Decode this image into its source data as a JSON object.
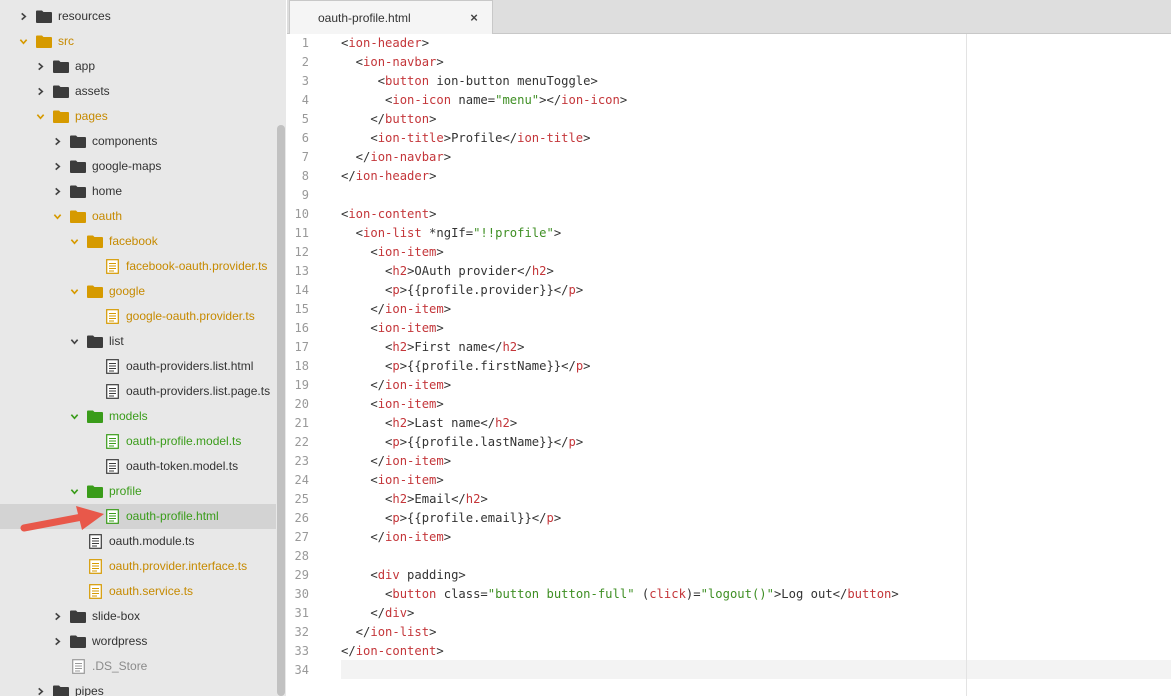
{
  "sidebar": {
    "items": [
      {
        "label": "resources",
        "indent": 1,
        "chevron": "right",
        "icon": "folder",
        "color": "dark"
      },
      {
        "label": "src",
        "indent": 1,
        "chevron": "down",
        "icon": "folder",
        "color": "orange"
      },
      {
        "label": "app",
        "indent": 2,
        "chevron": "right",
        "icon": "folder",
        "color": "dark"
      },
      {
        "label": "assets",
        "indent": 2,
        "chevron": "right",
        "icon": "folder",
        "color": "dark"
      },
      {
        "label": "pages",
        "indent": 2,
        "chevron": "down",
        "icon": "folder",
        "color": "orange"
      },
      {
        "label": "components",
        "indent": 3,
        "chevron": "right",
        "icon": "folder",
        "color": "dark"
      },
      {
        "label": "google-maps",
        "indent": 3,
        "chevron": "right",
        "icon": "folder",
        "color": "dark"
      },
      {
        "label": "home",
        "indent": 3,
        "chevron": "right",
        "icon": "folder",
        "color": "dark"
      },
      {
        "label": "oauth",
        "indent": 3,
        "chevron": "down",
        "icon": "folder",
        "color": "orange"
      },
      {
        "label": "facebook",
        "indent": 4,
        "chevron": "down",
        "icon": "folder",
        "color": "orange"
      },
      {
        "label": "facebook-oauth.provider.ts",
        "indent": 5,
        "chevron": "none",
        "icon": "file",
        "color": "orange"
      },
      {
        "label": "google",
        "indent": 4,
        "chevron": "down",
        "icon": "folder",
        "color": "orange"
      },
      {
        "label": "google-oauth.provider.ts",
        "indent": 5,
        "chevron": "none",
        "icon": "file",
        "color": "orange"
      },
      {
        "label": "list",
        "indent": 4,
        "chevron": "down",
        "icon": "folder",
        "color": "dark"
      },
      {
        "label": "oauth-providers.list.html",
        "indent": 5,
        "chevron": "none",
        "icon": "file",
        "color": "dark"
      },
      {
        "label": "oauth-providers.list.page.ts",
        "indent": 5,
        "chevron": "none",
        "icon": "file",
        "color": "dark"
      },
      {
        "label": "models",
        "indent": 4,
        "chevron": "down",
        "icon": "folder",
        "color": "green"
      },
      {
        "label": "oauth-profile.model.ts",
        "indent": 5,
        "chevron": "none",
        "icon": "file",
        "color": "green"
      },
      {
        "label": "oauth-token.model.ts",
        "indent": 5,
        "chevron": "none",
        "icon": "file",
        "color": "dark"
      },
      {
        "label": "profile",
        "indent": 4,
        "chevron": "down",
        "icon": "folder",
        "color": "green"
      },
      {
        "label": "oauth-profile.html",
        "indent": 5,
        "chevron": "none",
        "icon": "file",
        "color": "green",
        "selected": true
      },
      {
        "label": "oauth.module.ts",
        "indent": 4,
        "chevron": "none",
        "icon": "file",
        "color": "dark"
      },
      {
        "label": "oauth.provider.interface.ts",
        "indent": 4,
        "chevron": "none",
        "icon": "file",
        "color": "orange"
      },
      {
        "label": "oauth.service.ts",
        "indent": 4,
        "chevron": "none",
        "icon": "file",
        "color": "orange"
      },
      {
        "label": "slide-box",
        "indent": 3,
        "chevron": "right",
        "icon": "folder",
        "color": "dark"
      },
      {
        "label": "wordpress",
        "indent": 3,
        "chevron": "right",
        "icon": "folder",
        "color": "dark"
      },
      {
        "label": ".DS_Store",
        "indent": 3,
        "chevron": "none",
        "icon": "file",
        "color": "grey"
      },
      {
        "label": "pipes",
        "indent": 2,
        "chevron": "right",
        "icon": "folder",
        "color": "dark"
      }
    ]
  },
  "tabs": [
    {
      "label": "oauth-profile.html",
      "close_glyph": "×"
    }
  ],
  "colors": {
    "dark": "#333333",
    "orange": "#c68a00",
    "green": "#3a9c1a",
    "grey": "#8a8a8a",
    "tag": "#c4363a",
    "string": "#3f8f24",
    "arrow": "#e8584a"
  },
  "editor": {
    "lines": [
      [
        {
          "t": "",
          "c": "a"
        },
        {
          "t": "<",
          "c": "a"
        },
        {
          "t": "ion-header",
          "c": "t"
        },
        {
          "t": ">",
          "c": "a"
        }
      ],
      [
        {
          "t": "  <",
          "c": "a"
        },
        {
          "t": "ion-navbar",
          "c": "t"
        },
        {
          "t": ">",
          "c": "a"
        }
      ],
      [
        {
          "t": "     <",
          "c": "a"
        },
        {
          "t": "button",
          "c": "t"
        },
        {
          "t": " ion-button menuToggle>",
          "c": "a"
        }
      ],
      [
        {
          "t": "      <",
          "c": "a"
        },
        {
          "t": "ion-icon",
          "c": "t"
        },
        {
          "t": " name=",
          "c": "a"
        },
        {
          "t": "\"menu\"",
          "c": "s"
        },
        {
          "t": "></",
          "c": "a"
        },
        {
          "t": "ion-icon",
          "c": "t"
        },
        {
          "t": ">",
          "c": "a"
        }
      ],
      [
        {
          "t": "    </",
          "c": "a"
        },
        {
          "t": "button",
          "c": "t"
        },
        {
          "t": ">",
          "c": "a"
        }
      ],
      [
        {
          "t": "    <",
          "c": "a"
        },
        {
          "t": "ion-title",
          "c": "t"
        },
        {
          "t": ">Profile</",
          "c": "a"
        },
        {
          "t": "ion-title",
          "c": "t"
        },
        {
          "t": ">",
          "c": "a"
        }
      ],
      [
        {
          "t": "  </",
          "c": "a"
        },
        {
          "t": "ion-navbar",
          "c": "t"
        },
        {
          "t": ">",
          "c": "a"
        }
      ],
      [
        {
          "t": "</",
          "c": "a"
        },
        {
          "t": "ion-header",
          "c": "t"
        },
        {
          "t": ">",
          "c": "a"
        }
      ],
      [],
      [
        {
          "t": "<",
          "c": "a"
        },
        {
          "t": "ion-content",
          "c": "t"
        },
        {
          "t": ">",
          "c": "a"
        }
      ],
      [
        {
          "t": "  <",
          "c": "a"
        },
        {
          "t": "ion-list",
          "c": "t"
        },
        {
          "t": " *ngIf=",
          "c": "a"
        },
        {
          "t": "\"!!profile\"",
          "c": "s"
        },
        {
          "t": ">",
          "c": "a"
        }
      ],
      [
        {
          "t": "    <",
          "c": "a"
        },
        {
          "t": "ion-item",
          "c": "t"
        },
        {
          "t": ">",
          "c": "a"
        }
      ],
      [
        {
          "t": "      <",
          "c": "a"
        },
        {
          "t": "h2",
          "c": "t"
        },
        {
          "t": ">OAuth provider</",
          "c": "a"
        },
        {
          "t": "h2",
          "c": "t"
        },
        {
          "t": ">",
          "c": "a"
        }
      ],
      [
        {
          "t": "      <",
          "c": "a"
        },
        {
          "t": "p",
          "c": "t"
        },
        {
          "t": ">{{profile.provider}}</",
          "c": "a"
        },
        {
          "t": "p",
          "c": "t"
        },
        {
          "t": ">",
          "c": "a"
        }
      ],
      [
        {
          "t": "    </",
          "c": "a"
        },
        {
          "t": "ion-item",
          "c": "t"
        },
        {
          "t": ">",
          "c": "a"
        }
      ],
      [
        {
          "t": "    <",
          "c": "a"
        },
        {
          "t": "ion-item",
          "c": "t"
        },
        {
          "t": ">",
          "c": "a"
        }
      ],
      [
        {
          "t": "      <",
          "c": "a"
        },
        {
          "t": "h2",
          "c": "t"
        },
        {
          "t": ">First name</",
          "c": "a"
        },
        {
          "t": "h2",
          "c": "t"
        },
        {
          "t": ">",
          "c": "a"
        }
      ],
      [
        {
          "t": "      <",
          "c": "a"
        },
        {
          "t": "p",
          "c": "t"
        },
        {
          "t": ">{{profile.firstName}}</",
          "c": "a"
        },
        {
          "t": "p",
          "c": "t"
        },
        {
          "t": ">",
          "c": "a"
        }
      ],
      [
        {
          "t": "    </",
          "c": "a"
        },
        {
          "t": "ion-item",
          "c": "t"
        },
        {
          "t": ">",
          "c": "a"
        }
      ],
      [
        {
          "t": "    <",
          "c": "a"
        },
        {
          "t": "ion-item",
          "c": "t"
        },
        {
          "t": ">",
          "c": "a"
        }
      ],
      [
        {
          "t": "      <",
          "c": "a"
        },
        {
          "t": "h2",
          "c": "t"
        },
        {
          "t": ">Last name</",
          "c": "a"
        },
        {
          "t": "h2",
          "c": "t"
        },
        {
          "t": ">",
          "c": "a"
        }
      ],
      [
        {
          "t": "      <",
          "c": "a"
        },
        {
          "t": "p",
          "c": "t"
        },
        {
          "t": ">{{profile.lastName}}</",
          "c": "a"
        },
        {
          "t": "p",
          "c": "t"
        },
        {
          "t": ">",
          "c": "a"
        }
      ],
      [
        {
          "t": "    </",
          "c": "a"
        },
        {
          "t": "ion-item",
          "c": "t"
        },
        {
          "t": ">",
          "c": "a"
        }
      ],
      [
        {
          "t": "    <",
          "c": "a"
        },
        {
          "t": "ion-item",
          "c": "t"
        },
        {
          "t": ">",
          "c": "a"
        }
      ],
      [
        {
          "t": "      <",
          "c": "a"
        },
        {
          "t": "h2",
          "c": "t"
        },
        {
          "t": ">Email</",
          "c": "a"
        },
        {
          "t": "h2",
          "c": "t"
        },
        {
          "t": ">",
          "c": "a"
        }
      ],
      [
        {
          "t": "      <",
          "c": "a"
        },
        {
          "t": "p",
          "c": "t"
        },
        {
          "t": ">{{profile.email}}</",
          "c": "a"
        },
        {
          "t": "p",
          "c": "t"
        },
        {
          "t": ">",
          "c": "a"
        }
      ],
      [
        {
          "t": "    </",
          "c": "a"
        },
        {
          "t": "ion-item",
          "c": "t"
        },
        {
          "t": ">",
          "c": "a"
        }
      ],
      [],
      [
        {
          "t": "    <",
          "c": "a"
        },
        {
          "t": "div",
          "c": "t"
        },
        {
          "t": " padding>",
          "c": "a"
        }
      ],
      [
        {
          "t": "      <",
          "c": "a"
        },
        {
          "t": "button",
          "c": "t"
        },
        {
          "t": " class=",
          "c": "a"
        },
        {
          "t": "\"button button-full\"",
          "c": "s"
        },
        {
          "t": " (",
          "c": "a"
        },
        {
          "t": "click",
          "c": "t"
        },
        {
          "t": ")=",
          "c": "a"
        },
        {
          "t": "\"logout()\"",
          "c": "s"
        },
        {
          "t": ">Log out</",
          "c": "a"
        },
        {
          "t": "button",
          "c": "t"
        },
        {
          "t": ">",
          "c": "a"
        }
      ],
      [
        {
          "t": "    </",
          "c": "a"
        },
        {
          "t": "div",
          "c": "t"
        },
        {
          "t": ">",
          "c": "a"
        }
      ],
      [
        {
          "t": "  </",
          "c": "a"
        },
        {
          "t": "ion-list",
          "c": "t"
        },
        {
          "t": ">",
          "c": "a"
        }
      ],
      [
        {
          "t": "</",
          "c": "a"
        },
        {
          "t": "ion-content",
          "c": "t"
        },
        {
          "t": ">",
          "c": "a"
        }
      ],
      []
    ],
    "line_numbers": [
      "1",
      "2",
      "3",
      "4",
      "5",
      "6",
      "7",
      "8",
      "9",
      "10",
      "11",
      "12",
      "13",
      "14",
      "15",
      "16",
      "17",
      "18",
      "19",
      "20",
      "21",
      "22",
      "23",
      "24",
      "25",
      "26",
      "27",
      "28",
      "29",
      "30",
      "31",
      "32",
      "33",
      "34"
    ]
  }
}
